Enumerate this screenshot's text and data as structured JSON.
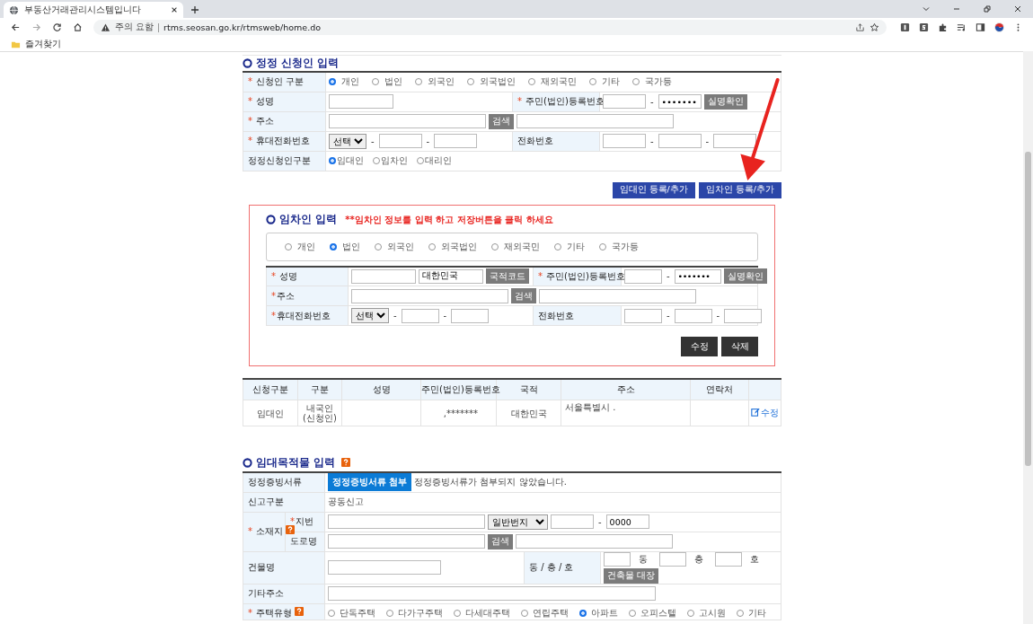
{
  "browser": {
    "tab_title": "부동산거래관리시스템입니다",
    "security_label": "주의 요함",
    "url": "rtms.seosan.go.kr/rtmsweb/home.do",
    "bookmark": "즐겨찾기"
  },
  "applicant": {
    "title": "정정 신청인 입력",
    "type": {
      "label": {
        "mark": "*",
        "text": "신청인 구분"
      },
      "options": [
        {
          "label": "개인",
          "selected": true
        },
        {
          "label": "법인",
          "selected": false
        },
        {
          "label": "외국인",
          "selected": false
        },
        {
          "label": "외국법인",
          "selected": false
        },
        {
          "label": "재외국민",
          "selected": false
        },
        {
          "label": "기타",
          "selected": false
        },
        {
          "label": "국가등",
          "selected": false
        }
      ]
    },
    "name": {
      "label": {
        "mark": "*",
        "text": "성명"
      }
    },
    "rrn": {
      "label": {
        "mark": "*",
        "text": "주민(법인)등록번호"
      },
      "masked": "•••••••",
      "separator": "-",
      "button": "실명확인"
    },
    "address": {
      "label": {
        "mark": "*",
        "text": "주소"
      },
      "button": "검색"
    },
    "mobile": {
      "label": {
        "mark": "*",
        "text": "휴대전화번호"
      },
      "select": "선택",
      "separator": "-"
    },
    "phone": {
      "label": {
        "text": "전화번호"
      },
      "separator": "-"
    },
    "correction": {
      "label": {
        "text": "정정신청인구분"
      },
      "options": [
        {
          "label": "임대인",
          "selected": true
        },
        {
          "label": "임차인",
          "selected": false
        },
        {
          "label": "대리인",
          "selected": false
        }
      ]
    }
  },
  "actions": [
    "임대인 등록/추가",
    "임차인 등록/추가"
  ],
  "tenant": {
    "title": "임차인 입력",
    "note": "**임차인 정보를 입력 하고 저장버튼을 클릭 하세요",
    "options": [
      {
        "label": "개인",
        "selected": false
      },
      {
        "label": "법인",
        "selected": true
      },
      {
        "label": "외국인",
        "selected": false
      },
      {
        "label": "외국법인",
        "selected": false
      },
      {
        "label": "재외국민",
        "selected": false
      },
      {
        "label": "기타",
        "selected": false
      },
      {
        "label": "국가등",
        "selected": false
      }
    ],
    "name": {
      "label": {
        "mark": "*",
        "text": "성명"
      },
      "nationality": "대한민국",
      "button": "국적코드"
    },
    "rrn": {
      "label": {
        "mark": "*",
        "text": "주민(법인)등록번호"
      },
      "masked": "•••••••",
      "separator": "-",
      "button": "실명확인"
    },
    "address": {
      "label": {
        "mark": "*",
        "text": "주소"
      },
      "button": "검색"
    },
    "mobile": {
      "label": {
        "mark": "*",
        "text": "휴대전화번호"
      },
      "select": "선택",
      "separator": "-"
    },
    "phone": {
      "label": {
        "text": "전화번호"
      },
      "separator": "-"
    },
    "buttons": [
      "수정",
      "삭제"
    ]
  },
  "parties_table": {
    "columns": [
      "신청구분",
      "구분",
      "성명",
      "주민(법인)등록번호",
      "국적",
      "주소",
      "연락처"
    ],
    "rows": [
      {
        "cells": [
          "임대인",
          "내국인 (신청인)",
          "",
          ",*******",
          "대한민국",
          "서울특별시 .",
          ""
        ],
        "edit": "수정"
      }
    ]
  },
  "property": {
    "title": "임대목적물 입력",
    "help": true,
    "evidence": {
      "label": {
        "text": "정정증빙서류"
      },
      "button": "정정증빙서류 첨부",
      "note": "정정증빙서류가 첨부되지 않았습니다."
    },
    "report_type": {
      "label": {
        "text": "신고구분"
      },
      "value": "공동신고"
    },
    "location": {
      "label": {
        "mark": "*",
        "text": "소재지"
      },
      "help": true,
      "lot": {
        "label": {
          "mark": "*",
          "text": "지번"
        },
        "select": "일반번지",
        "separator": "-",
        "number": "0000"
      },
      "road": {
        "label": {
          "text": "도로명"
        },
        "button": "검색"
      }
    },
    "building": {
      "label": {
        "text": "건물명"
      },
      "unit_label": "동 / 층 / 호",
      "units": [
        "동",
        "층",
        "호"
      ],
      "button": "건축물 대장"
    },
    "other": {
      "label": {
        "text": "기타주소"
      }
    },
    "housing": {
      "label": {
        "mark": "*",
        "text": "주택유형"
      },
      "help": true,
      "options": [
        {
          "label": "단독주택",
          "selected": false
        },
        {
          "label": "다가구주택",
          "selected": false
        },
        {
          "label": "다세대주택",
          "selected": false
        },
        {
          "label": "연립주택",
          "selected": false
        },
        {
          "label": "아파트",
          "selected": true
        },
        {
          "label": "오피스텔",
          "selected": false
        },
        {
          "label": "고시원",
          "selected": false
        },
        {
          "label": "기타",
          "selected": false
        }
      ]
    }
  }
}
